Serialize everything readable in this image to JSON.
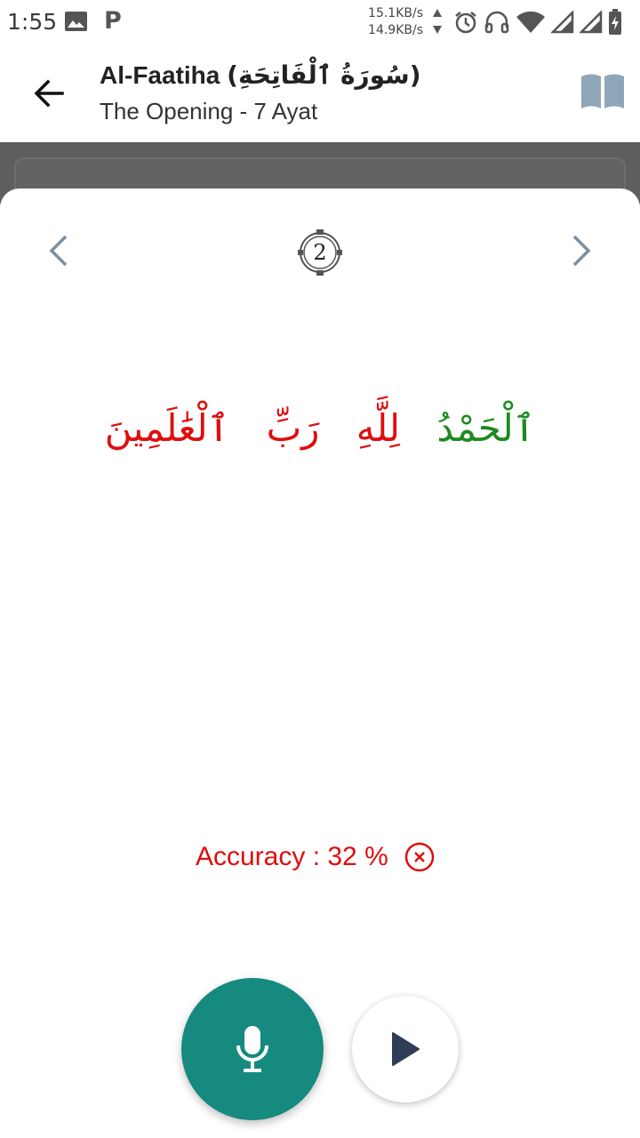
{
  "status_bar": {
    "time": "1:55",
    "upload_speed": "15.1KB/s",
    "download_speed": "14.9KB/s",
    "icons": [
      "image-icon",
      "p-icon",
      "data-arrows-icon",
      "alarm-icon",
      "headphones-icon",
      "wifi-icon",
      "signal-icon",
      "signal-icon",
      "battery-charging-icon"
    ]
  },
  "app_bar": {
    "title": "Al-Faatiha",
    "title_arabic": "(سُورَةُ ٱلْفَاتِحَةِ)",
    "subtitle": "The Opening - 7 Ayat"
  },
  "sheet": {
    "ayah_number": "2",
    "verse_words": [
      {
        "text": "ٱلْحَمْدُ",
        "status": "correct"
      },
      {
        "text": "لِلَّهِ",
        "status": "incorrect"
      },
      {
        "text": "رَبِّ",
        "status": "incorrect"
      },
      {
        "text": "ٱلْعَٰلَمِينَ",
        "status": "incorrect"
      }
    ],
    "accuracy_text": "Accuracy : 32 %"
  },
  "colors": {
    "correct": "#1e8a1e",
    "incorrect": "#e00d0d",
    "mic_button": "#168a7e",
    "nav_arrow": "#7d8fa3",
    "book_icon": "#8fa6b8"
  }
}
